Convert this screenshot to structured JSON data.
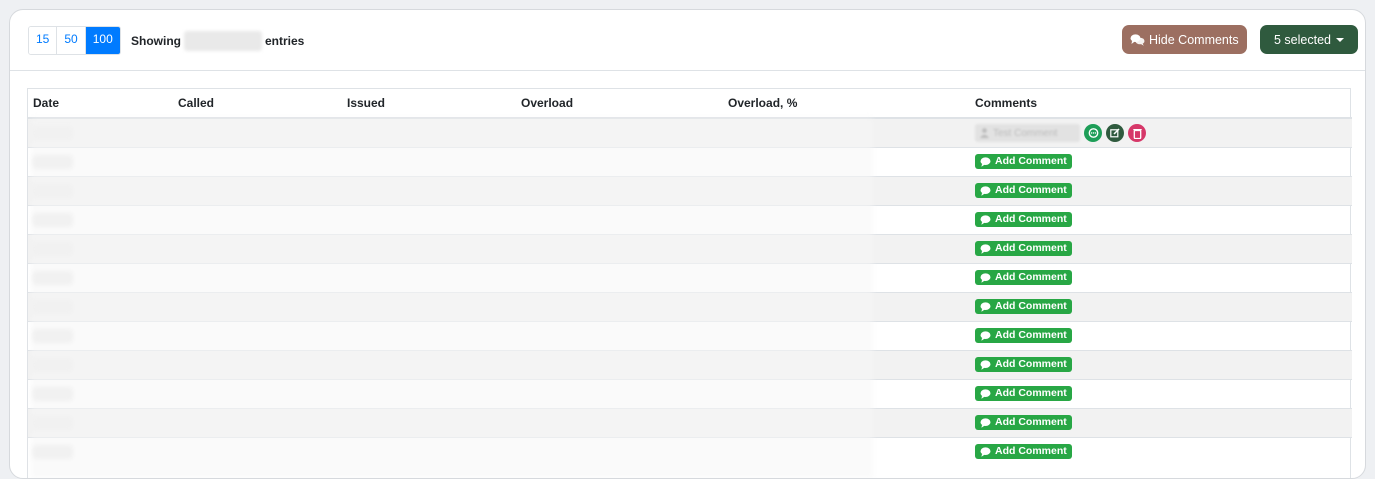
{
  "toolbar": {
    "page_sizes": [
      "15",
      "50",
      "100"
    ],
    "active_page_size": "100",
    "showing_prefix": "Showing",
    "showing_suffix": "entries",
    "hide_comments_label": "Hide Comments",
    "selected_label": "5 selected"
  },
  "table": {
    "headers": [
      "Date",
      "Called",
      "Issued",
      "Overload",
      "Overload, %",
      "Comments"
    ],
    "first_row_comment": "Test Comment",
    "add_comment_label": "Add Comment",
    "add_comment_rows": 11
  },
  "colors": {
    "primary": "#007bff",
    "hide_comments_bg": "#9c6f61",
    "selected_bg": "#2f5a3e",
    "add_comment_bg": "#28a745",
    "delete_icon": "#d63869"
  }
}
